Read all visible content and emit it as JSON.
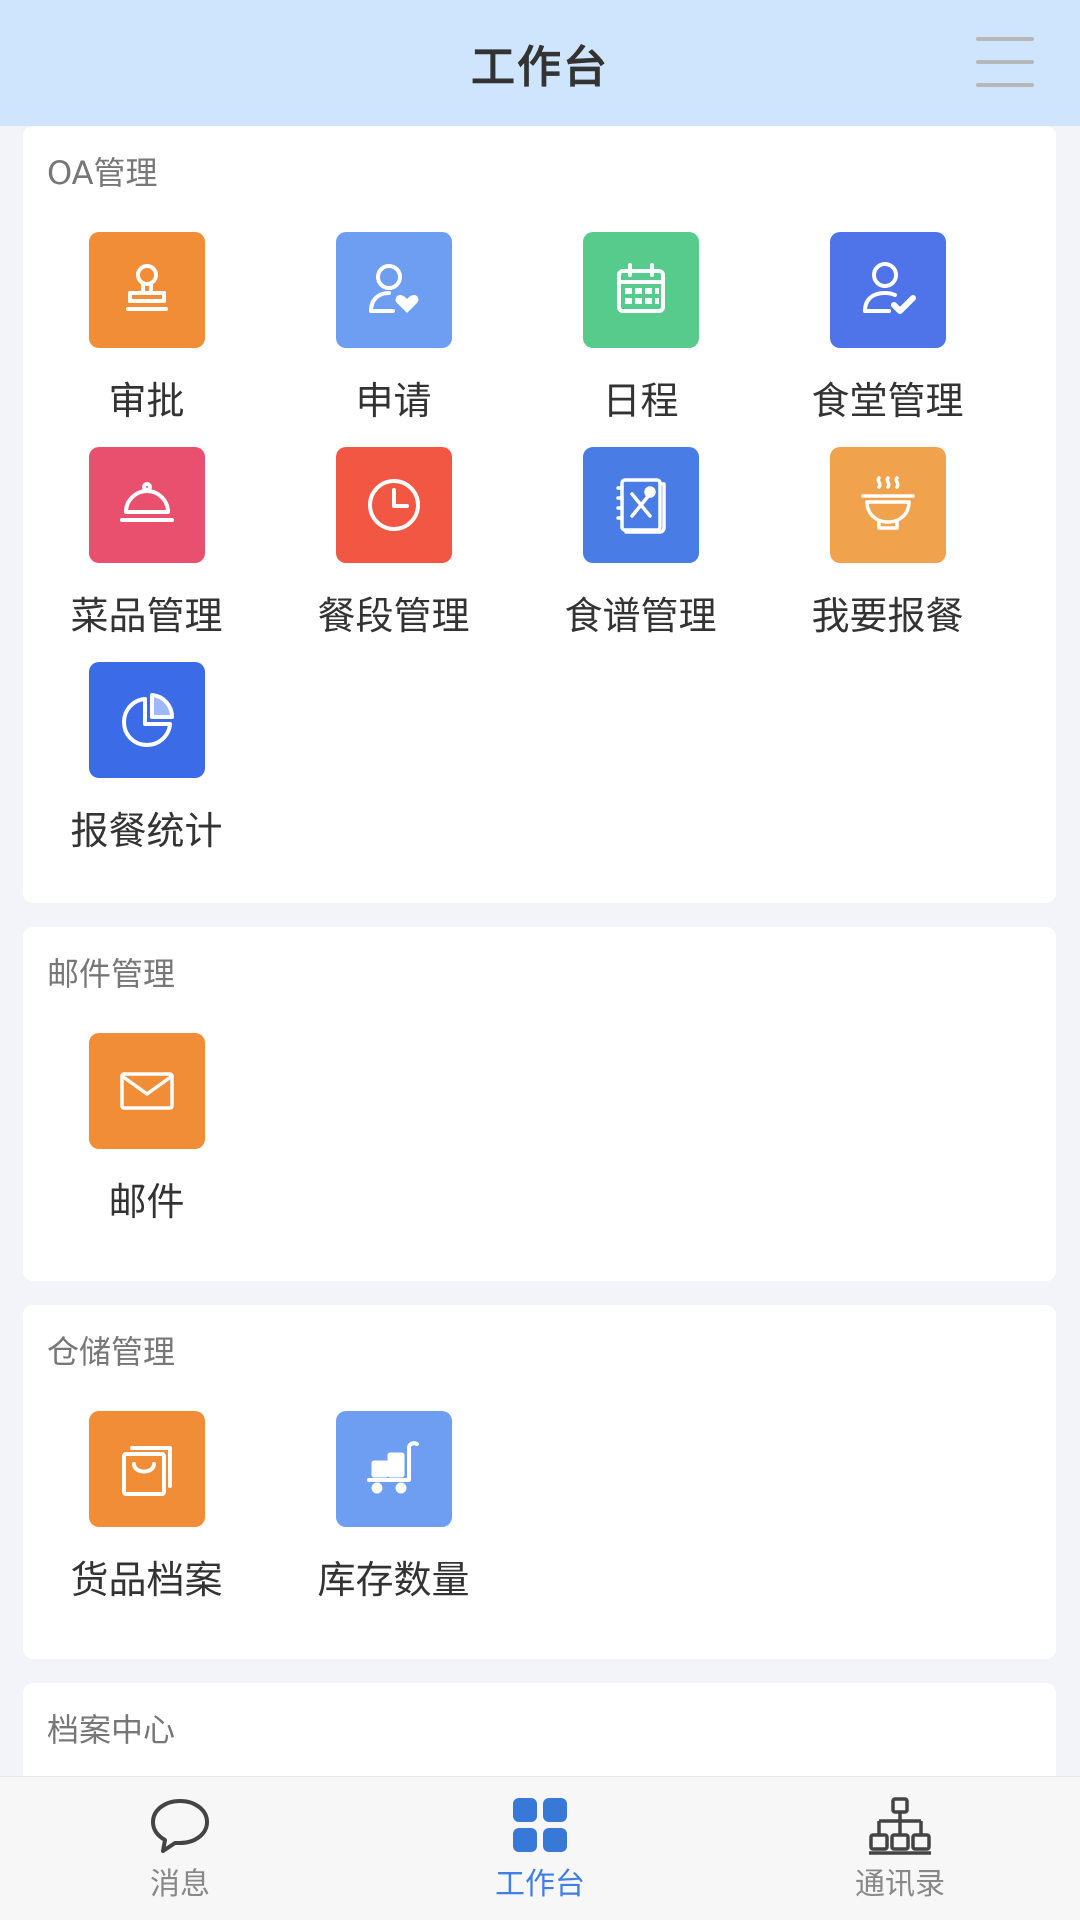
{
  "header": {
    "title": "工作台"
  },
  "colors": {
    "header_bg": "#cfe5fd",
    "orange": "#f18d36",
    "light_blue": "#6d9ef2",
    "green": "#56cb8c",
    "royal_blue": "#4f73e8",
    "pink": "#e9506d",
    "red": "#f15742",
    "blue": "#4a7ce6",
    "amber": "#f1a24c",
    "active_tab": "#3f7fe6"
  },
  "sections": [
    {
      "title": "OA管理",
      "items": [
        {
          "label": "审批",
          "icon": "stamp-icon"
        },
        {
          "label": "申请",
          "icon": "user-heart-icon"
        },
        {
          "label": "日程",
          "icon": "calendar-icon"
        },
        {
          "label": "食堂管理",
          "icon": "user-check-icon"
        },
        {
          "label": "菜品管理",
          "icon": "dish-cloche-icon"
        },
        {
          "label": "餐段管理",
          "icon": "clock-icon"
        },
        {
          "label": "食谱管理",
          "icon": "recipe-book-icon"
        },
        {
          "label": "我要报餐",
          "icon": "bowl-icon"
        },
        {
          "label": "报餐统计",
          "icon": "pie-chart-icon"
        }
      ]
    },
    {
      "title": "邮件管理",
      "items": [
        {
          "label": "邮件",
          "icon": "mail-icon"
        }
      ]
    },
    {
      "title": "仓储管理",
      "items": [
        {
          "label": "货品档案",
          "icon": "shopping-bag-icon"
        },
        {
          "label": "库存数量",
          "icon": "cart-icon"
        }
      ]
    },
    {
      "title": "档案中心",
      "items": []
    }
  ],
  "tabbar": [
    {
      "label": "消息",
      "icon": "chat-bubble-icon"
    },
    {
      "label": "工作台",
      "icon": "grid-icon",
      "active": true
    },
    {
      "label": "通讯录",
      "icon": "org-chart-icon"
    }
  ]
}
